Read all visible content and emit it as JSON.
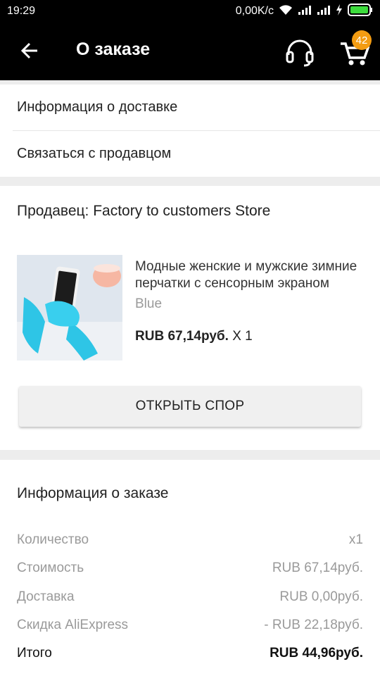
{
  "status_bar": {
    "time": "19:29",
    "speed": "0,00K/c",
    "icons": [
      "wifi-icon",
      "signal-icon",
      "signal-icon",
      "charging-icon",
      "battery-icon"
    ]
  },
  "app_bar": {
    "title": "О заказе",
    "back_icon": "arrow-left-icon",
    "support_icon": "headset-icon",
    "cart_icon": "cart-icon",
    "cart_count": "42",
    "accent": "#f39c12"
  },
  "links": {
    "delivery_info": "Информация о доставке",
    "contact_seller": "Связаться с продавцом"
  },
  "order": {
    "seller": "Продавец: Factory to customers Store",
    "product": {
      "name": "Модные женские и мужские зимние перчатки с сенсорным экраном",
      "variant": "Blue",
      "price": "RUB 67,14руб.",
      "qty": "X 1"
    },
    "dispute_button": "ОТКРЫТЬ СПОР"
  },
  "order_info": {
    "title": "Информация о заказе",
    "rows": [
      {
        "label": "Количество",
        "value": "x1"
      },
      {
        "label": "Стоимость",
        "value": "RUB 67,14руб."
      },
      {
        "label": "Доставка",
        "value": "RUB 0,00руб."
      },
      {
        "label": "Скидка AliExpress",
        "value": "- RUB 22,18руб."
      },
      {
        "label": "Итого",
        "value": "RUB 44,96руб."
      }
    ]
  }
}
